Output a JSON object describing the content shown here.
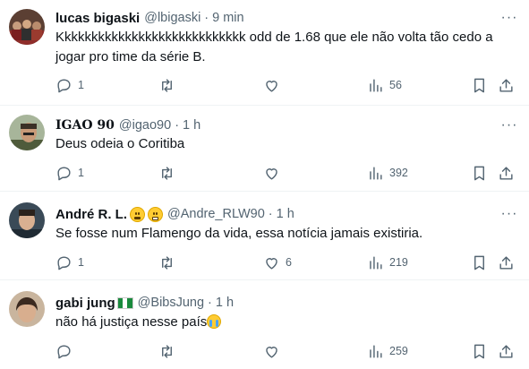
{
  "tweets": [
    {
      "name": "lucas bigaski",
      "handle": "@lbigaski",
      "time": "9 min",
      "text": "Kkkkkkkkkkkkkkkkkkkkkkkkkkkk odd de 1.68 que ele não volta tão cedo a jogar pro time da série B.",
      "replies": "1",
      "retweets": "",
      "likes": "",
      "views": "56",
      "avatar_color": "#6b4a3a"
    },
    {
      "name": "IGAO 90",
      "handle": "@igao90",
      "time": "1 h",
      "text": "Deus odeia o Coritiba",
      "replies": "1",
      "retweets": "",
      "likes": "",
      "views": "392",
      "avatar_color": "#7c8a5a"
    },
    {
      "name": "André R. L.",
      "handle": "@Andre_RLW90",
      "time": "1 h",
      "text": "Se fosse num Flamengo da vida, essa notícia jamais existiria.",
      "replies": "1",
      "retweets": "",
      "likes": "6",
      "views": "219",
      "avatar_color": "#3d4f5c"
    },
    {
      "name": "gabi jung",
      "handle": "@BibsJung",
      "time": "1 h",
      "text": "não há justiça nesse país",
      "replies": "",
      "retweets": "",
      "likes": "",
      "views": "259",
      "avatar_color": "#8a6a55"
    }
  ],
  "separator": "·",
  "more_glyph": "···",
  "icons": {
    "reply": "reply-icon",
    "retweet": "retweet-icon",
    "like": "like-icon",
    "views": "views-icon",
    "bookmark": "bookmark-icon",
    "share": "share-icon"
  },
  "colors": {
    "text": "#0f1419",
    "secondary": "#536471",
    "divider": "#eff3f4"
  }
}
